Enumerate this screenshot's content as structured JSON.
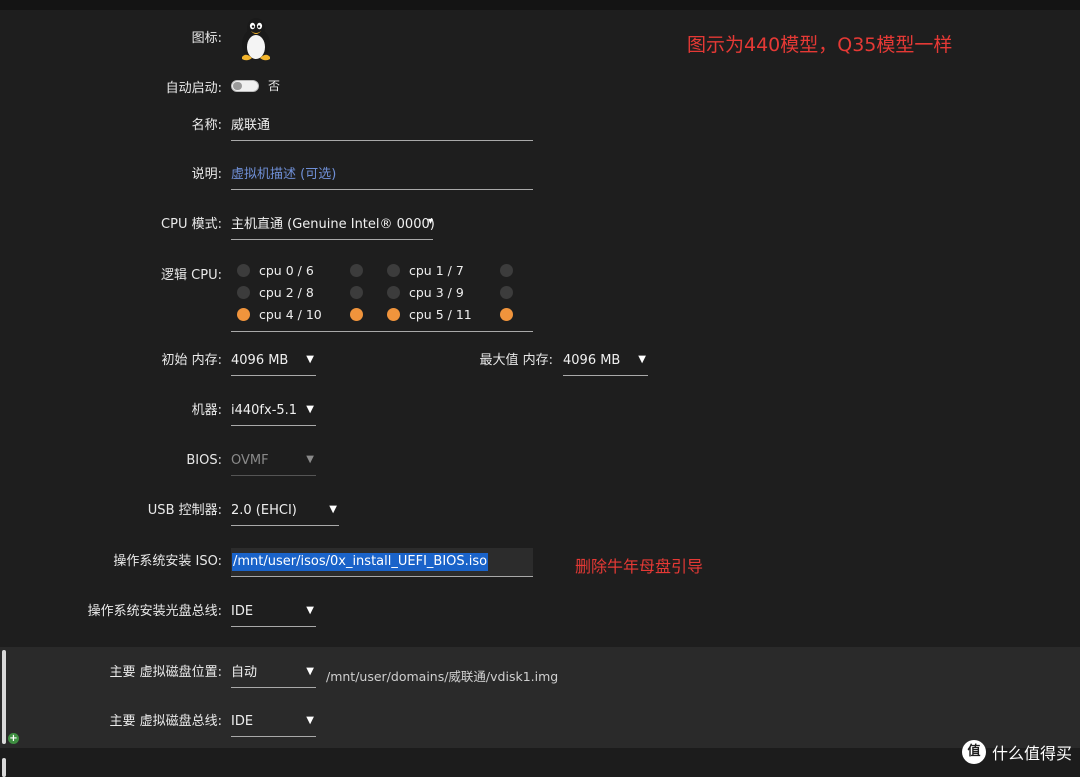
{
  "icon_row": {
    "label": "图标:",
    "icon": "linux-penguin-icon"
  },
  "autostart": {
    "label": "自动启动:",
    "state_text": "否",
    "enabled": false
  },
  "name": {
    "label": "名称:",
    "value": "威联通"
  },
  "description": {
    "label": "说明:",
    "placeholder": "虚拟机描述 (可选)"
  },
  "cpu_mode": {
    "label": "CPU 模式:",
    "value": "主机直通 (Genuine Intel® 0000)",
    "caret": "▾"
  },
  "logical_cpu": {
    "label": "逻辑 CPU:",
    "pairs": [
      {
        "label": "cpu 0 / 6",
        "a": false,
        "b": false
      },
      {
        "label": "cpu 1 / 7",
        "a": false,
        "b": false
      },
      {
        "label": "cpu 2 / 8",
        "a": false,
        "b": false
      },
      {
        "label": "cpu 3 / 9",
        "a": false,
        "b": false
      },
      {
        "label": "cpu 4 / 10",
        "a": true,
        "b": true
      },
      {
        "label": "cpu 5 / 11",
        "a": true,
        "b": true
      }
    ]
  },
  "memory": {
    "initial_label": "初始 内存:",
    "initial_value": "4096 MB",
    "max_label": "最大值 内存:",
    "max_value": "4096 MB"
  },
  "machine": {
    "label": "机器:",
    "value": "i440fx-5.1"
  },
  "bios": {
    "label": "BIOS:",
    "value": "OVMF"
  },
  "usb": {
    "label": "USB 控制器:",
    "value": "2.0 (EHCI)"
  },
  "os_iso": {
    "label": "操作系统安装 ISO:",
    "value": "/mnt/user/isos/0x_install_UEFI_BIOS.iso"
  },
  "os_bus": {
    "label": "操作系统安装光盘总线:",
    "value": "IDE"
  },
  "vdisk_location": {
    "label": "主要 虚拟磁盘位置:",
    "value": "自动",
    "path": "/mnt/user/domains/威联通/vdisk1.img"
  },
  "vdisk_bus": {
    "label": "主要 虚拟磁盘总线:",
    "value": "IDE"
  },
  "annotations": {
    "top": "图示为440模型，Q35模型一样",
    "iso": "删除牛年母盘引导"
  },
  "watermark": {
    "badge": "值",
    "text": "什么值得买"
  },
  "caret": "▼",
  "colors": {
    "accent_orange": "#f0943c",
    "annotation_red": "#e53935",
    "selection_blue": "#1a63c9"
  }
}
